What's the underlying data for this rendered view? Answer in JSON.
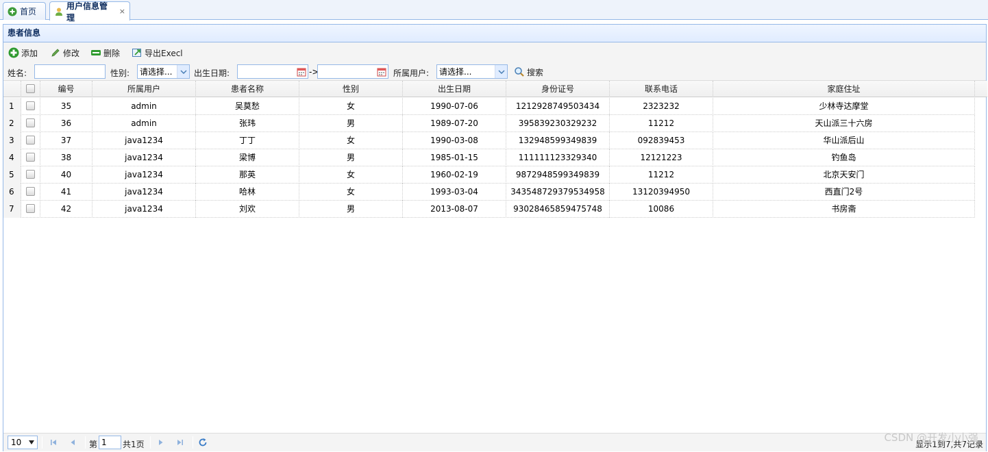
{
  "tabs": [
    {
      "label": "首页",
      "icon": "home-add-icon"
    },
    {
      "label": "用户信息管理",
      "icon": "user-icon",
      "close": "×"
    }
  ],
  "panel": {
    "title": "患者信息"
  },
  "toolbar": {
    "add": "添加",
    "edit": "修改",
    "delete": "删除",
    "export": "导出Execl"
  },
  "search": {
    "name_label": "姓名:",
    "gender_label": "性别:",
    "gender_value": "请选择...",
    "birth_label": "出生日期:",
    "range_sep": "->",
    "owner_label": "所属用户:",
    "owner_value": "请选择...",
    "search_button": "搜索"
  },
  "grid": {
    "columns": [
      "编号",
      "所属用户",
      "患者名称",
      "性别",
      "出生日期",
      "身份证号",
      "联系电话",
      "家庭住址"
    ],
    "rows": [
      {
        "n": "1",
        "id": "35",
        "owner": "admin",
        "name": "吴莫愁",
        "gender": "女",
        "birth": "1990-07-06",
        "idcard": "1212928749503434",
        "phone": "2323232",
        "address": "少林寺达摩堂"
      },
      {
        "n": "2",
        "id": "36",
        "owner": "admin",
        "name": "张玮",
        "gender": "男",
        "birth": "1989-07-20",
        "idcard": "395839230329232",
        "phone": "11212",
        "address": "天山派三十六房"
      },
      {
        "n": "3",
        "id": "37",
        "owner": "java1234",
        "name": "丁丁",
        "gender": "女",
        "birth": "1990-03-08",
        "idcard": "132948599349839",
        "phone": "092839453",
        "address": "华山派后山"
      },
      {
        "n": "4",
        "id": "38",
        "owner": "java1234",
        "name": "梁博",
        "gender": "男",
        "birth": "1985-01-15",
        "idcard": "111111123329340",
        "phone": "12121223",
        "address": "钓鱼岛"
      },
      {
        "n": "5",
        "id": "40",
        "owner": "java1234",
        "name": "那英",
        "gender": "女",
        "birth": "1960-02-19",
        "idcard": "9872948599349839",
        "phone": "11212",
        "address": "北京天安门"
      },
      {
        "n": "6",
        "id": "41",
        "owner": "java1234",
        "name": "哈林",
        "gender": "女",
        "birth": "1993-03-04",
        "idcard": "343548729379534958",
        "phone": "13120394950",
        "address": "西直门2号"
      },
      {
        "n": "7",
        "id": "42",
        "owner": "java1234",
        "name": "刘欢",
        "gender": "男",
        "birth": "2013-08-07",
        "idcard": "93028465859475748",
        "phone": "10086",
        "address": "书房斋"
      }
    ]
  },
  "pager": {
    "page_size": "10",
    "page_prefix": "第",
    "page_value": "1",
    "page_suffix": "共1页",
    "info": "显示1到7,共7记录"
  },
  "watermark": "CSDN @开发小小强",
  "colors": {
    "border": "#95b8e7",
    "header_bg": "#e0ecff",
    "accent": "#0e2d5f"
  }
}
